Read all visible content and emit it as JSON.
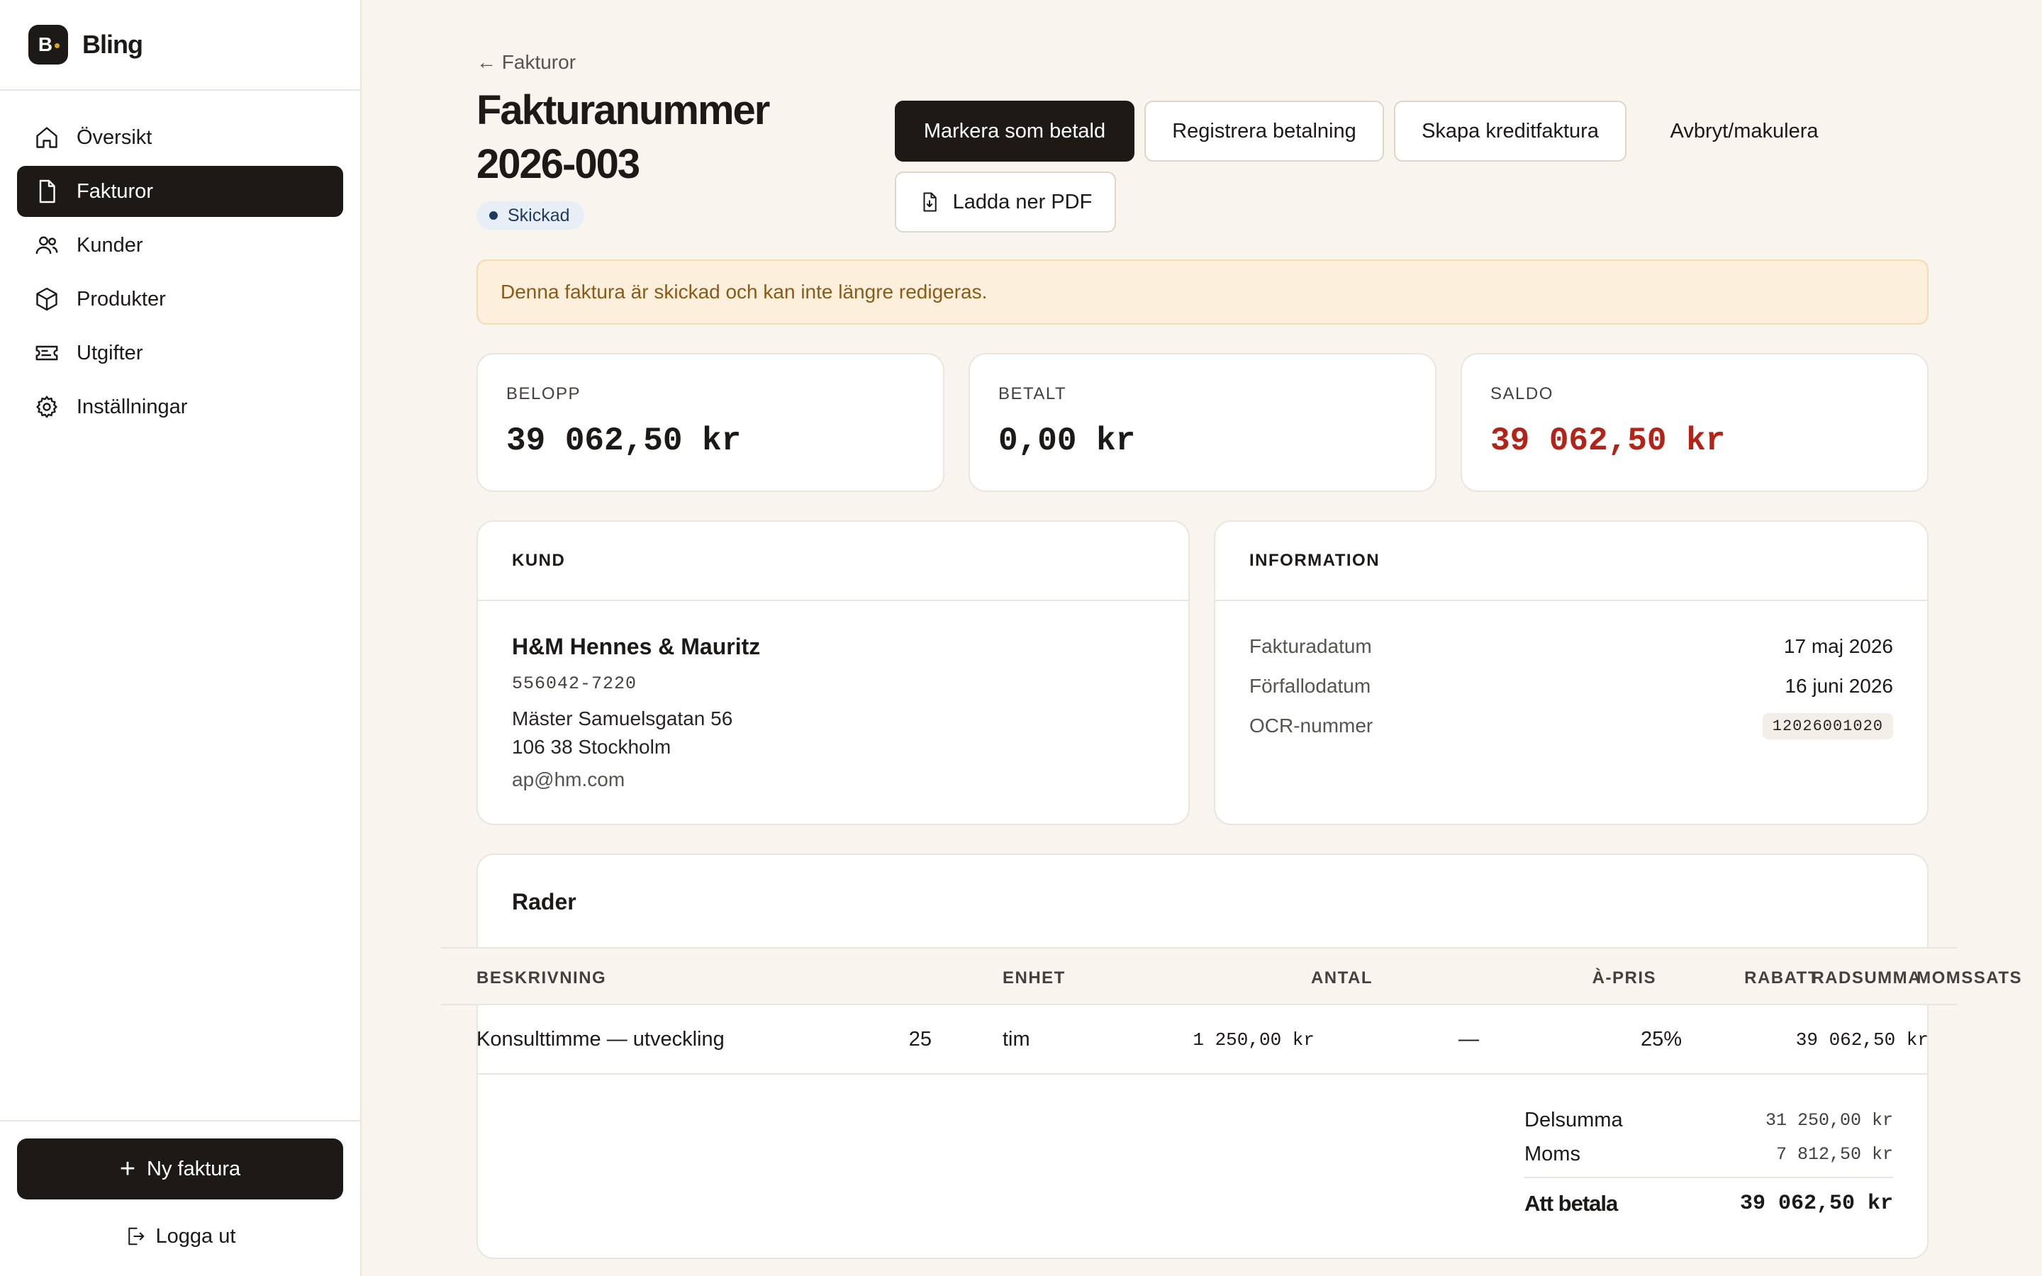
{
  "brand": {
    "logo_letter": "B",
    "name": "Bling"
  },
  "sidebar": {
    "items": [
      {
        "label": "Översikt",
        "icon": "home-icon",
        "active": false
      },
      {
        "label": "Fakturor",
        "icon": "document-icon",
        "active": true
      },
      {
        "label": "Kunder",
        "icon": "users-icon",
        "active": false
      },
      {
        "label": "Produkter",
        "icon": "box-icon",
        "active": false
      },
      {
        "label": "Utgifter",
        "icon": "receipt-icon",
        "active": false
      },
      {
        "label": "Inställningar",
        "icon": "gear-icon",
        "active": false
      }
    ],
    "new_invoice": "Ny faktura",
    "logout": "Logga ut"
  },
  "header": {
    "back_label": "← Fakturor",
    "title": "Fakturanummer 2026-003",
    "status": "Skickad"
  },
  "actions": {
    "mark_paid": "Markera som betald",
    "register_payment": "Registrera betalning",
    "credit_invoice": "Skapa kreditfaktura",
    "cancel": "Avbryt/makulera",
    "download_pdf": "Ladda ner PDF"
  },
  "alert": "Denna faktura är skickad och kan inte längre redigeras.",
  "stats": {
    "amount": {
      "label": "BELOPP",
      "value": "39 062,50 kr"
    },
    "paid": {
      "label": "BETALT",
      "value": "0,00 kr"
    },
    "balance": {
      "label": "SALDO",
      "value": "39 062,50 kr"
    }
  },
  "customer": {
    "heading": "KUND",
    "name": "H&M Hennes & Mauritz",
    "org_no": "556042-7220",
    "street": "Mäster Samuelsgatan 56",
    "city": "106 38 Stockholm",
    "email": "ap@hm.com"
  },
  "information": {
    "heading": "INFORMATION",
    "invoice_date_label": "Fakturadatum",
    "invoice_date": "17 maj 2026",
    "due_date_label": "Förfallodatum",
    "due_date": "16 juni 2026",
    "ocr_label": "OCR-nummer",
    "ocr": "12026001020"
  },
  "rows": {
    "title": "Rader",
    "columns": {
      "description": "BESKRIVNING",
      "quantity": "ANTAL",
      "unit": "ENHET",
      "unit_price": "À-PRIS",
      "discount": "RABATT",
      "vat_rate": "MOMSSATS",
      "row_total": "RADSUMMA"
    },
    "items": [
      {
        "description": "Konsulttimme — utveckling",
        "quantity": "25",
        "unit": "tim",
        "unit_price": "1 250,00 kr",
        "discount": "—",
        "vat_rate": "25%",
        "row_total": "39 062,50 kr"
      }
    ]
  },
  "totals": {
    "subtotal_label": "Delsumma",
    "subtotal": "31 250,00 kr",
    "vat_label": "Moms",
    "vat": "7 812,50 kr",
    "total_label": "Att betala",
    "total": "39 062,50 kr"
  },
  "colors": {
    "background": "#f8f5ef",
    "primary": "#1c1917",
    "status_badge": "#e8eef6",
    "alert_bg": "#fcf0dc",
    "alert_text": "#8a5a16",
    "balance_red": "#b42318"
  }
}
